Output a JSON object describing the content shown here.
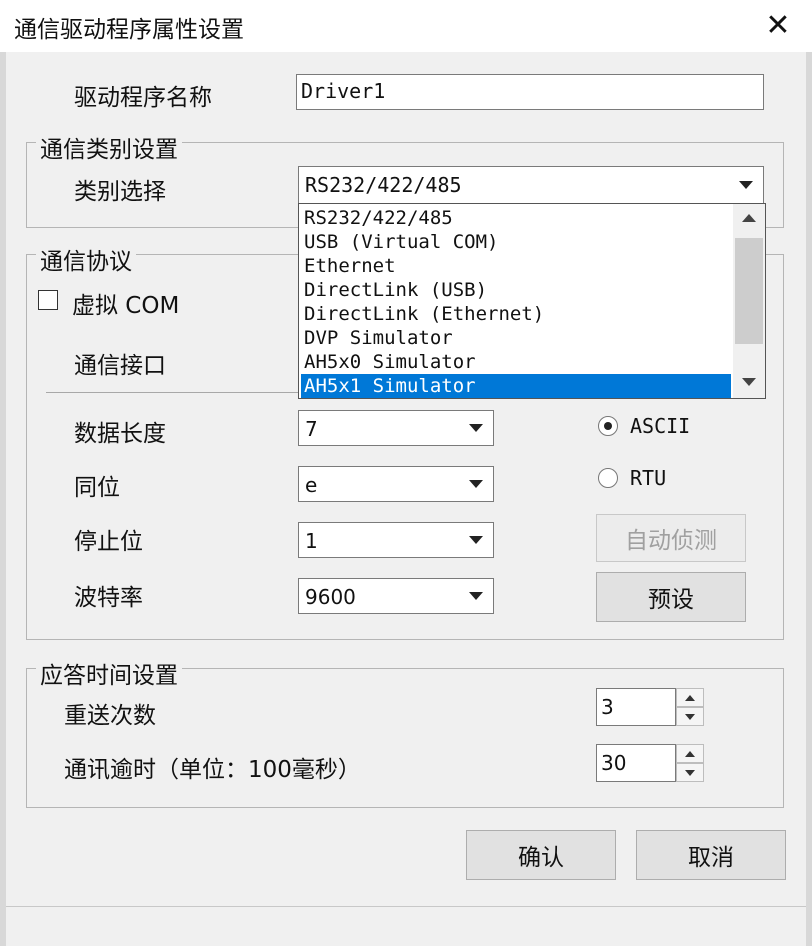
{
  "window": {
    "title": "通信驱动程序属性设置"
  },
  "driver_name": {
    "label": "驱动程序名称",
    "value": "Driver1"
  },
  "category_group": {
    "title": "通信类别设置",
    "select_label": "类别选择",
    "selected": "RS232/422/485",
    "options": [
      "RS232/422/485",
      "USB (Virtual COM)",
      "Ethernet",
      "DirectLink (USB)",
      "DirectLink (Ethernet)",
      "DVP Simulator",
      "AH5x0 Simulator",
      "AH5x1 Simulator"
    ],
    "highlighted_index": 7
  },
  "protocol_group": {
    "title": "通信协议",
    "virtual_com_label": "虚拟 COM",
    "port_label": "通信接口",
    "data_length": {
      "label": "数据长度",
      "value": "7"
    },
    "parity": {
      "label": "同位",
      "value": "e"
    },
    "stop_bits": {
      "label": "停止位",
      "value": "1"
    },
    "baud_rate": {
      "label": "波特率",
      "value": "9600"
    },
    "mode_ascii": "ASCII",
    "mode_rtu": "RTU",
    "auto_detect_label": "自动侦测",
    "preset_label": "预设"
  },
  "response_group": {
    "title": "应答时间设置",
    "retries": {
      "label": "重送次数",
      "value": "3"
    },
    "timeout": {
      "label": "通讯逾时（单位：100毫秒）",
      "value": "30"
    }
  },
  "buttons": {
    "ok": "确认",
    "cancel": "取消"
  }
}
